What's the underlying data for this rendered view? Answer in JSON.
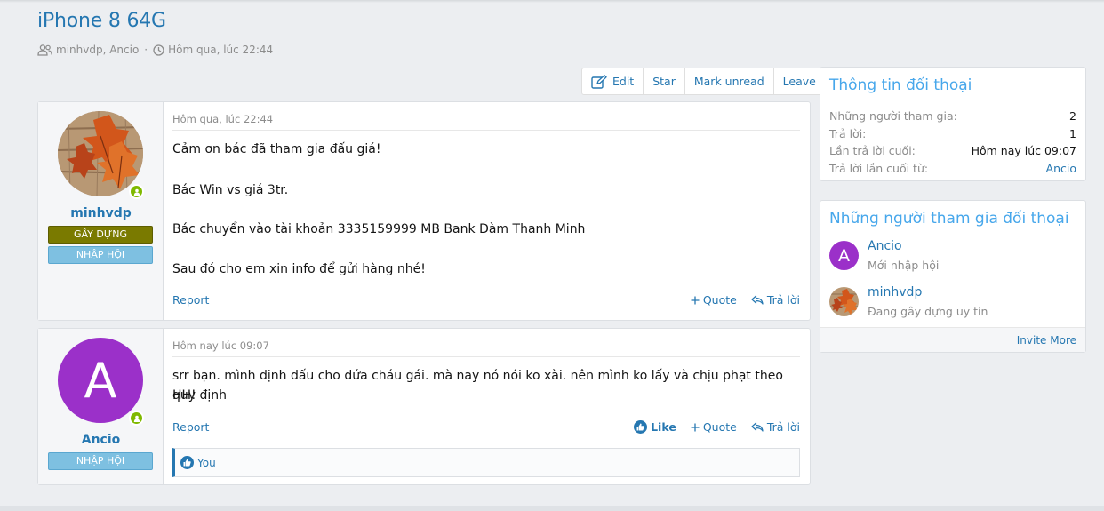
{
  "thread": {
    "title": "iPhone 8 64G",
    "participants": "minhvdp, Ancio",
    "separator": "·",
    "date": "Hôm qua, lúc 22:44"
  },
  "toolbar": {
    "edit": "Edit",
    "star": "Star",
    "mark_unread": "Mark unread",
    "leave": "Leave"
  },
  "messages": [
    {
      "username": "minhvdp",
      "badges": [
        "GÂY DỰNG",
        "NHẬP HỘI"
      ],
      "date": "Hôm qua, lúc 22:44",
      "lines": [
        "Cảm ơn bác đã tham gia đấu giá!",
        "Bác Win vs giá 3tr.",
        "Bác chuyển vào tài khoản 3335159999 MB Bank Đàm Thanh Minh",
        "Sau đó cho em xin info để gửi hàng nhé!"
      ],
      "report": "Report",
      "quote": "Quote",
      "reply": "Trả lời"
    },
    {
      "username": "Ancio",
      "avatar_letter": "A",
      "badges": [
        "NHẬP HỘI"
      ],
      "date": "Hôm nay lúc 09:07",
      "lines": [
        "srr bạn. mình định đấu cho đứa cháu gái. mà nay nó nói ko xài. nên mình ko lấy và chịu phạt theo quy định",
        "HH!"
      ],
      "report": "Report",
      "like": "Like",
      "quote": "Quote",
      "reply": "Trả lời",
      "reactions": "You"
    }
  ],
  "sidebar": {
    "info": {
      "title": "Thông tin đối thoại",
      "rows": [
        {
          "label": "Những người tham gia:",
          "value": "2"
        },
        {
          "label": "Trả lời:",
          "value": "1"
        },
        {
          "label": "Lần trả lời cuối:",
          "value": "Hôm nay lúc 09:07"
        },
        {
          "label": "Trả lời lần cuối từ:",
          "value": "Ancio"
        }
      ]
    },
    "participants": {
      "title": "Những người tham gia đối thoại",
      "members": [
        {
          "name": "Ancio",
          "letter": "A",
          "title": "Mới nhập hội"
        },
        {
          "name": "minhvdp",
          "title": "Đang gây dựng uy tín"
        }
      ],
      "invite": "Invite More"
    }
  },
  "colors": {
    "link": "#2577b1",
    "accent_title": "#47a7eb",
    "avatar_purple": "#9b30c9",
    "online": "#7fb900"
  }
}
